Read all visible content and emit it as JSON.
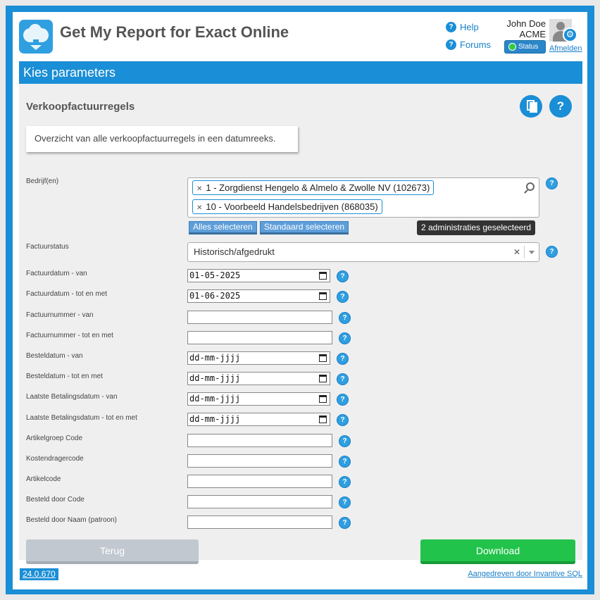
{
  "header": {
    "app_title": "Get My Report for Exact Online",
    "help_label": "Help",
    "forums_label": "Forums",
    "user_name": "John Doe",
    "organization": "ACME",
    "status_label": "Status",
    "logout_label": "Afmelden"
  },
  "section_title": "Kies parameters",
  "report": {
    "title": "Verkoopfactuurregels",
    "description": "Overzicht van alle verkoopfactuurregels in een datumreeks."
  },
  "companies": {
    "label": "Bedrijf(en)",
    "selected": [
      "1 - Zorgdienst Hengelo & Almelo & Zwolle NV (102673)",
      "10 - Voorbeeld Handelsbedrijven (868035)"
    ],
    "select_all_label": "Alles selecteren",
    "select_default_label": "Standaard selecteren",
    "count_badge": "2 administraties geselecteerd"
  },
  "invoice_status": {
    "label": "Factuurstatus",
    "value": "Historisch/afgedrukt"
  },
  "fields": [
    {
      "label": "Factuurdatum - van",
      "value": "01-05-2025",
      "type": "date"
    },
    {
      "label": "Factuurdatum - tot en met",
      "value": "01-06-2025",
      "type": "date"
    },
    {
      "label": "Factuurnummer - van",
      "value": "",
      "type": "text"
    },
    {
      "label": "Factuurnummer - tot en met",
      "value": "",
      "type": "text"
    },
    {
      "label": "Besteldatum - van",
      "value": "dd-mm-jjjj",
      "type": "date"
    },
    {
      "label": "Besteldatum - tot en met",
      "value": "dd-mm-jjjj",
      "type": "date"
    },
    {
      "label": "Laatste Betalingsdatum - van",
      "value": "dd-mm-jjjj",
      "type": "date"
    },
    {
      "label": "Laatste Betalingsdatum - tot en met",
      "value": "dd-mm-jjjj",
      "type": "date"
    },
    {
      "label": "Artikelgroep Code",
      "value": "",
      "type": "text"
    },
    {
      "label": "Kostendragercode",
      "value": "",
      "type": "text"
    },
    {
      "label": "Artikelcode",
      "value": "",
      "type": "text"
    },
    {
      "label": "Besteld door Code",
      "value": "",
      "type": "text"
    },
    {
      "label": "Besteld door Naam (patroon)",
      "value": "",
      "type": "text"
    }
  ],
  "buttons": {
    "back_label": "Terug",
    "download_label": "Download"
  },
  "footer": {
    "version": "24.0.670",
    "powered_by": "Aangedreven door Invantive SQL"
  },
  "colors": {
    "accent": "#1a8ed6",
    "download": "#22c34b",
    "back": "#c2c8d0"
  }
}
